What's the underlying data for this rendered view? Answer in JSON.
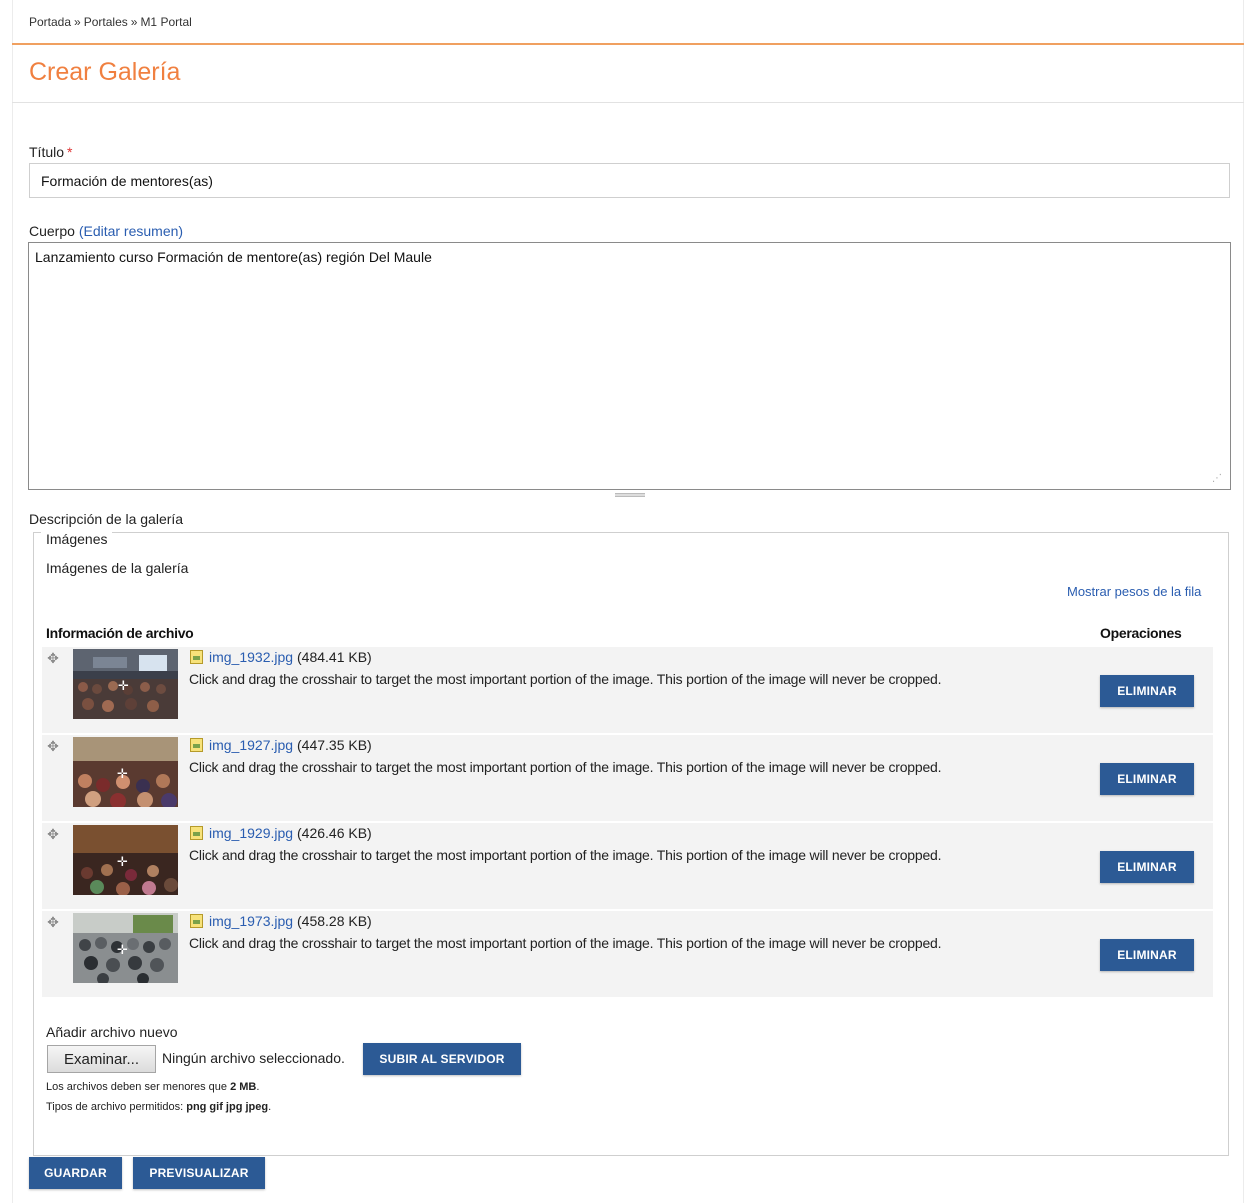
{
  "breadcrumb": {
    "items": [
      "Portada",
      "Portales",
      "M1 Portal"
    ],
    "separator": "»"
  },
  "page": {
    "title": "Crear Galería"
  },
  "form": {
    "title_label": "Título",
    "required_marker": "*",
    "title_value": "Formación de mentores(as)",
    "body_label": "Cuerpo",
    "edit_summary_link": "(Editar resumen)",
    "body_value": "Lanzamiento curso Formación de mentore(as) región Del Maule",
    "gallery_description_label": "Descripción de la galería"
  },
  "images": {
    "legend": "Imágenes",
    "section_label": "Imágenes de la galería",
    "show_weights_link": "Mostrar pesos de la fila",
    "col_file_info": "Información de archivo",
    "col_operations": "Operaciones",
    "crop_hint": "Click and drag the crosshair to target the most important portion of the image. This portion of the image will never be cropped.",
    "delete_label": "ELIMINAR",
    "files": [
      {
        "name": "img_1932.jpg",
        "size": "(484.41 KB)"
      },
      {
        "name": "img_1927.jpg",
        "size": "(447.35 KB)"
      },
      {
        "name": "img_1929.jpg",
        "size": "(426.46 KB)"
      },
      {
        "name": "img_1973.jpg",
        "size": "(458.28 KB)"
      }
    ],
    "add_new_label": "Añadir archivo nuevo",
    "browse_label": "Examinar...",
    "no_file_label": "Ningún archivo seleccionado.",
    "upload_label": "SUBIR AL SERVIDOR",
    "size_note_prefix": "Los archivos deben ser menores que",
    "size_limit": "2 MB",
    "types_note_prefix": "Tipos de archivo permitidos:",
    "types": "png gif jpg jpeg"
  },
  "actions": {
    "save_label": "GUARDAR",
    "preview_label": "PREVISUALIZAR"
  },
  "colors": {
    "accent": "#f08040",
    "button": "#2c5a95",
    "link": "#2a5db0"
  }
}
